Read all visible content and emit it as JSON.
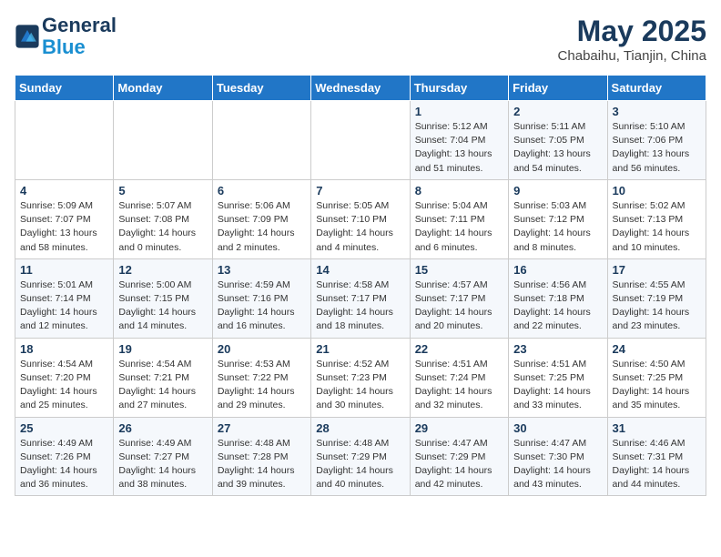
{
  "logo": {
    "line1": "General",
    "line2": "Blue"
  },
  "title": "May 2025",
  "subtitle": "Chabaihu, Tianjin, China",
  "header_days": [
    "Sunday",
    "Monday",
    "Tuesday",
    "Wednesday",
    "Thursday",
    "Friday",
    "Saturday"
  ],
  "weeks": [
    [
      {
        "day": "",
        "info": ""
      },
      {
        "day": "",
        "info": ""
      },
      {
        "day": "",
        "info": ""
      },
      {
        "day": "",
        "info": ""
      },
      {
        "day": "1",
        "info": "Sunrise: 5:12 AM\nSunset: 7:04 PM\nDaylight: 13 hours\nand 51 minutes."
      },
      {
        "day": "2",
        "info": "Sunrise: 5:11 AM\nSunset: 7:05 PM\nDaylight: 13 hours\nand 54 minutes."
      },
      {
        "day": "3",
        "info": "Sunrise: 5:10 AM\nSunset: 7:06 PM\nDaylight: 13 hours\nand 56 minutes."
      }
    ],
    [
      {
        "day": "4",
        "info": "Sunrise: 5:09 AM\nSunset: 7:07 PM\nDaylight: 13 hours\nand 58 minutes."
      },
      {
        "day": "5",
        "info": "Sunrise: 5:07 AM\nSunset: 7:08 PM\nDaylight: 14 hours\nand 0 minutes."
      },
      {
        "day": "6",
        "info": "Sunrise: 5:06 AM\nSunset: 7:09 PM\nDaylight: 14 hours\nand 2 minutes."
      },
      {
        "day": "7",
        "info": "Sunrise: 5:05 AM\nSunset: 7:10 PM\nDaylight: 14 hours\nand 4 minutes."
      },
      {
        "day": "8",
        "info": "Sunrise: 5:04 AM\nSunset: 7:11 PM\nDaylight: 14 hours\nand 6 minutes."
      },
      {
        "day": "9",
        "info": "Sunrise: 5:03 AM\nSunset: 7:12 PM\nDaylight: 14 hours\nand 8 minutes."
      },
      {
        "day": "10",
        "info": "Sunrise: 5:02 AM\nSunset: 7:13 PM\nDaylight: 14 hours\nand 10 minutes."
      }
    ],
    [
      {
        "day": "11",
        "info": "Sunrise: 5:01 AM\nSunset: 7:14 PM\nDaylight: 14 hours\nand 12 minutes."
      },
      {
        "day": "12",
        "info": "Sunrise: 5:00 AM\nSunset: 7:15 PM\nDaylight: 14 hours\nand 14 minutes."
      },
      {
        "day": "13",
        "info": "Sunrise: 4:59 AM\nSunset: 7:16 PM\nDaylight: 14 hours\nand 16 minutes."
      },
      {
        "day": "14",
        "info": "Sunrise: 4:58 AM\nSunset: 7:17 PM\nDaylight: 14 hours\nand 18 minutes."
      },
      {
        "day": "15",
        "info": "Sunrise: 4:57 AM\nSunset: 7:17 PM\nDaylight: 14 hours\nand 20 minutes."
      },
      {
        "day": "16",
        "info": "Sunrise: 4:56 AM\nSunset: 7:18 PM\nDaylight: 14 hours\nand 22 minutes."
      },
      {
        "day": "17",
        "info": "Sunrise: 4:55 AM\nSunset: 7:19 PM\nDaylight: 14 hours\nand 23 minutes."
      }
    ],
    [
      {
        "day": "18",
        "info": "Sunrise: 4:54 AM\nSunset: 7:20 PM\nDaylight: 14 hours\nand 25 minutes."
      },
      {
        "day": "19",
        "info": "Sunrise: 4:54 AM\nSunset: 7:21 PM\nDaylight: 14 hours\nand 27 minutes."
      },
      {
        "day": "20",
        "info": "Sunrise: 4:53 AM\nSunset: 7:22 PM\nDaylight: 14 hours\nand 29 minutes."
      },
      {
        "day": "21",
        "info": "Sunrise: 4:52 AM\nSunset: 7:23 PM\nDaylight: 14 hours\nand 30 minutes."
      },
      {
        "day": "22",
        "info": "Sunrise: 4:51 AM\nSunset: 7:24 PM\nDaylight: 14 hours\nand 32 minutes."
      },
      {
        "day": "23",
        "info": "Sunrise: 4:51 AM\nSunset: 7:25 PM\nDaylight: 14 hours\nand 33 minutes."
      },
      {
        "day": "24",
        "info": "Sunrise: 4:50 AM\nSunset: 7:25 PM\nDaylight: 14 hours\nand 35 minutes."
      }
    ],
    [
      {
        "day": "25",
        "info": "Sunrise: 4:49 AM\nSunset: 7:26 PM\nDaylight: 14 hours\nand 36 minutes."
      },
      {
        "day": "26",
        "info": "Sunrise: 4:49 AM\nSunset: 7:27 PM\nDaylight: 14 hours\nand 38 minutes."
      },
      {
        "day": "27",
        "info": "Sunrise: 4:48 AM\nSunset: 7:28 PM\nDaylight: 14 hours\nand 39 minutes."
      },
      {
        "day": "28",
        "info": "Sunrise: 4:48 AM\nSunset: 7:29 PM\nDaylight: 14 hours\nand 40 minutes."
      },
      {
        "day": "29",
        "info": "Sunrise: 4:47 AM\nSunset: 7:29 PM\nDaylight: 14 hours\nand 42 minutes."
      },
      {
        "day": "30",
        "info": "Sunrise: 4:47 AM\nSunset: 7:30 PM\nDaylight: 14 hours\nand 43 minutes."
      },
      {
        "day": "31",
        "info": "Sunrise: 4:46 AM\nSunset: 7:31 PM\nDaylight: 14 hours\nand 44 minutes."
      }
    ]
  ]
}
